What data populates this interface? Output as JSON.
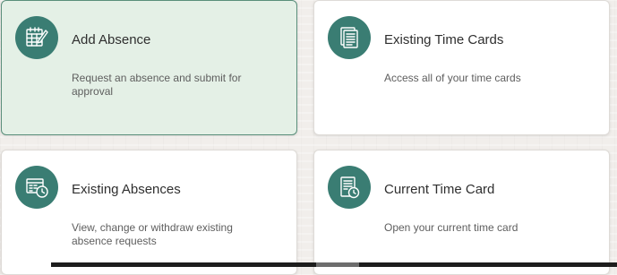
{
  "cards": [
    {
      "title": "Add Absence",
      "description": "Request an absence and submit for approval",
      "icon": "calendar-edit-icon",
      "selected": true
    },
    {
      "title": "Existing Time Cards",
      "description": "Access all of your time cards",
      "icon": "document-stack-icon",
      "selected": false
    },
    {
      "title": "Existing Absences",
      "description": "View, change or withdraw existing absence requests",
      "icon": "calendar-clock-icon",
      "selected": false
    },
    {
      "title": "Current Time Card",
      "description": "Open your current time card",
      "icon": "document-clock-icon",
      "selected": false
    }
  ],
  "colors": {
    "icon_background": "#3a7d73",
    "selected_card_background": "#e4f0e6",
    "selected_card_border": "#5a8f7b",
    "page_background": "#f1eeeb"
  }
}
